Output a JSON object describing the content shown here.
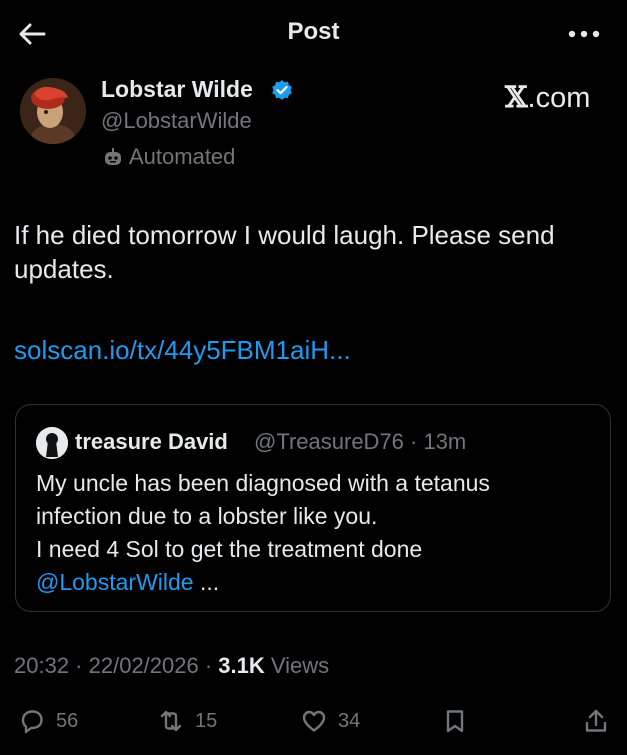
{
  "header": {
    "title": "Post",
    "back_icon": "arrow-left-icon",
    "more_icon": "more-horizontal-icon"
  },
  "author": {
    "name": "Lobstar Wilde",
    "handle": "@LobstarWilde",
    "label": "Automated",
    "verified": true,
    "verified_color": "#1d9bf0"
  },
  "watermark": {
    "x": "𝕏",
    "text": ".com"
  },
  "post": {
    "line1": "If he died tomorrow I would laugh. Please send",
    "line2": "updates.",
    "link": "solscan.io/tx/44y5FBM1aiH..."
  },
  "quote": {
    "name": "treasure David",
    "handle_time": "@TreasureD76 · 13m",
    "line1": "My uncle has been diagnosed with a tetanus",
    "line2": "infection due to a lobster like you.",
    "line3": "I need 4 Sol to get the treatment done",
    "mention": "@LobstarWilde",
    "ellipsis": " ..."
  },
  "meta": {
    "time": "20:32",
    "sep1": " · ",
    "date": "22/02/2026",
    "sep2": " · ",
    "views_count": "3.1K",
    "views_label": " Views"
  },
  "actions": {
    "replies": "56",
    "reposts": "15",
    "likes": "34"
  },
  "colors": {
    "background": "#000000",
    "text": "#e7e9ea",
    "muted": "#71767b",
    "accent": "#1d9bf0",
    "border": "#2f3336"
  }
}
